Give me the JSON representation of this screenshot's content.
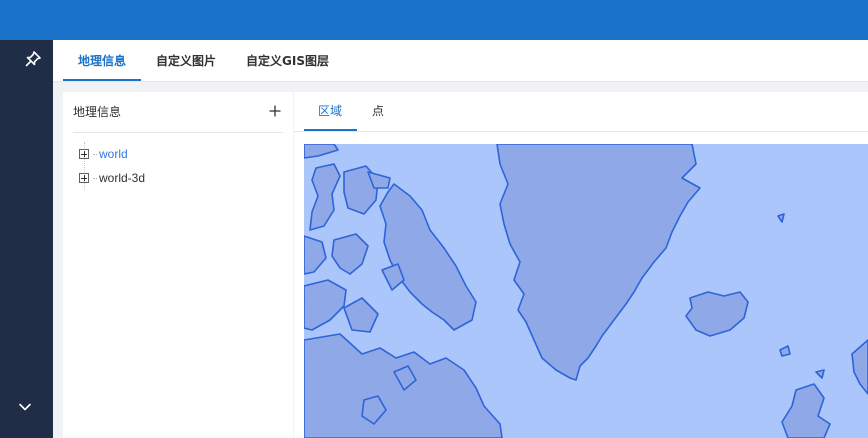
{
  "header": {},
  "sidebar": {
    "pin_icon": "pin-icon",
    "collapse_icon": "chevron-down-icon"
  },
  "tabs": [
    {
      "label": "地理信息",
      "active": true
    },
    {
      "label": "自定义图片",
      "active": false
    },
    {
      "label": "自定义GIS图层",
      "active": false
    }
  ],
  "geo_panel": {
    "title": "地理信息",
    "add_icon": "plus-icon",
    "tree": [
      {
        "label": "world",
        "selected": true
      },
      {
        "label": "world-3d",
        "selected": false
      }
    ]
  },
  "map_panel": {
    "tabs": [
      {
        "label": "区域",
        "active": true
      },
      {
        "label": "点",
        "active": false
      }
    ]
  },
  "colors": {
    "accent": "#1a73c8",
    "sidebar": "#1f2d47",
    "ocean": "#aac6fb",
    "land": "#8fa9e8",
    "border": "#2f63d8"
  }
}
